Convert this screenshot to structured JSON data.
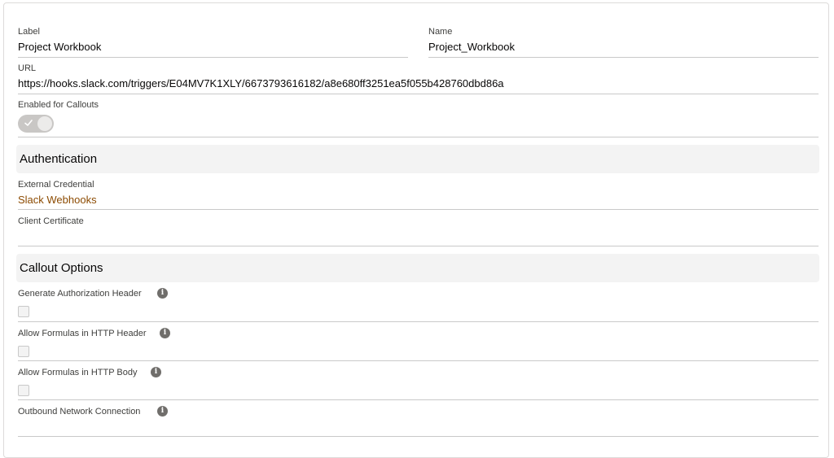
{
  "record": {
    "label_field": {
      "label": "Label",
      "value": "Project Workbook"
    },
    "name_field": {
      "label": "Name",
      "value": "Project_Workbook"
    },
    "url_field": {
      "label": "URL",
      "value": "https://hooks.slack.com/triggers/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"
    },
    "callouts_field": {
      "label": "Enabled for Callouts",
      "enabled": true
    }
  },
  "authentication": {
    "title": "Authentication",
    "external_credential": {
      "label": "External Credential",
      "value": "Slack Webhooks"
    },
    "client_certificate": {
      "label": "Client Certificate",
      "value": ""
    }
  },
  "callout_options": {
    "title": "Callout Options",
    "generate_auth_header": {
      "label": "Generate Authorization Header",
      "checked": false,
      "icon": "info-icon"
    },
    "formulas_header": {
      "label": "Allow Formulas in HTTP Header",
      "checked": false,
      "icon": "info-icon"
    },
    "formulas_body": {
      "label": "Allow Formulas in HTTP Body",
      "checked": false,
      "icon": "info-icon"
    },
    "outbound_connection": {
      "label": "Outbound Network Connection",
      "value": "",
      "icon": "info-icon"
    }
  },
  "colors": {
    "link": "#8c4b02",
    "section_bg": "#f3f3f3",
    "toggle_bg": "#c9c7c5"
  }
}
